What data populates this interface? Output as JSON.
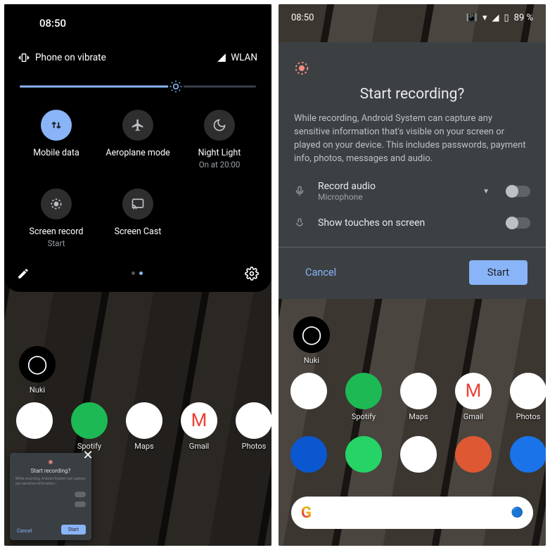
{
  "left": {
    "time": "08:50",
    "ringer_status": "Phone on vibrate",
    "network_label": "WLAN",
    "brightness_pct": 66,
    "tiles": [
      {
        "id": "mobile-data",
        "label": "Mobile data",
        "sub": "",
        "active": true
      },
      {
        "id": "airplane-mode",
        "label": "Aeroplane mode",
        "sub": "",
        "active": false
      },
      {
        "id": "night-light",
        "label": "Night Light",
        "sub": "On at 20:00",
        "active": false
      },
      {
        "id": "screen-record",
        "label": "Screen record",
        "sub": "Start",
        "active": false
      },
      {
        "id": "screen-cast",
        "label": "Screen Cast",
        "sub": "",
        "active": false
      }
    ],
    "mini_preview": {
      "title": "Start recording?",
      "cancel": "Cancel",
      "start": "Start"
    }
  },
  "right": {
    "time": "08:50",
    "battery_text": "89 %",
    "dialog": {
      "title": "Start recording?",
      "body": "While recording, Android System can capture any sensitive information that's visible on your screen or played on your device. This includes passwords, payment info, photos, messages and audio.",
      "audio_label": "Record audio",
      "audio_source": "Microphone",
      "touches_label": "Show touches on screen",
      "cancel": "Cancel",
      "start": "Start"
    }
  },
  "homescreen": {
    "row1": [
      {
        "name": "Nuki",
        "bg": "#000000",
        "glyph": "◯"
      }
    ],
    "row2": [
      {
        "name": "",
        "bg": "#ffffff",
        "glyph": ""
      },
      {
        "name": "Spotify",
        "bg": "#1db954",
        "glyph": ""
      },
      {
        "name": "Maps",
        "bg": "#ffffff",
        "glyph": ""
      },
      {
        "name": "Gmail",
        "bg": "#ffffff",
        "glyph": ""
      },
      {
        "name": "Photos",
        "bg": "#ffffff",
        "glyph": ""
      }
    ],
    "row3": [
      {
        "name": "",
        "bg": "#0b57d0",
        "glyph": ""
      },
      {
        "name": "",
        "bg": "#25d366",
        "glyph": ""
      },
      {
        "name": "",
        "bg": "#ffffff",
        "glyph": ""
      },
      {
        "name": "",
        "bg": "#de5833",
        "glyph": ""
      },
      {
        "name": "",
        "bg": "#1a73e8",
        "glyph": ""
      }
    ]
  }
}
